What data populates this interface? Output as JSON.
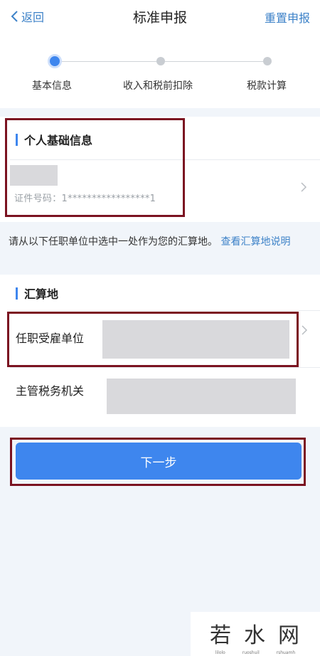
{
  "header": {
    "back_label": "返回",
    "title": "标准申报",
    "reset_label": "重置申报"
  },
  "steps": [
    {
      "label": "基本信息",
      "active": true
    },
    {
      "label": "收入和税前扣除",
      "active": false
    },
    {
      "label": "税款计算",
      "active": false
    }
  ],
  "personal": {
    "section_title": "个人基础信息",
    "id_label": "证件号码：1*****************1"
  },
  "notice": {
    "text": "请从以下任职单位中选中一处作为您的汇算地。",
    "link": "查看汇算地说明"
  },
  "settlement": {
    "section_title": "汇算地",
    "employer_label": "任职受雇单位",
    "tax_authority_label": "主管税务机关"
  },
  "next_button": "下一步",
  "watermark": {
    "text": "若水网",
    "sub": "lilolo ruoshuil rshuamh"
  },
  "colors": {
    "accent": "#3e86ee",
    "link": "#3d82c8",
    "highlight_box": "#7b1321",
    "background": "#f1f5fa"
  }
}
